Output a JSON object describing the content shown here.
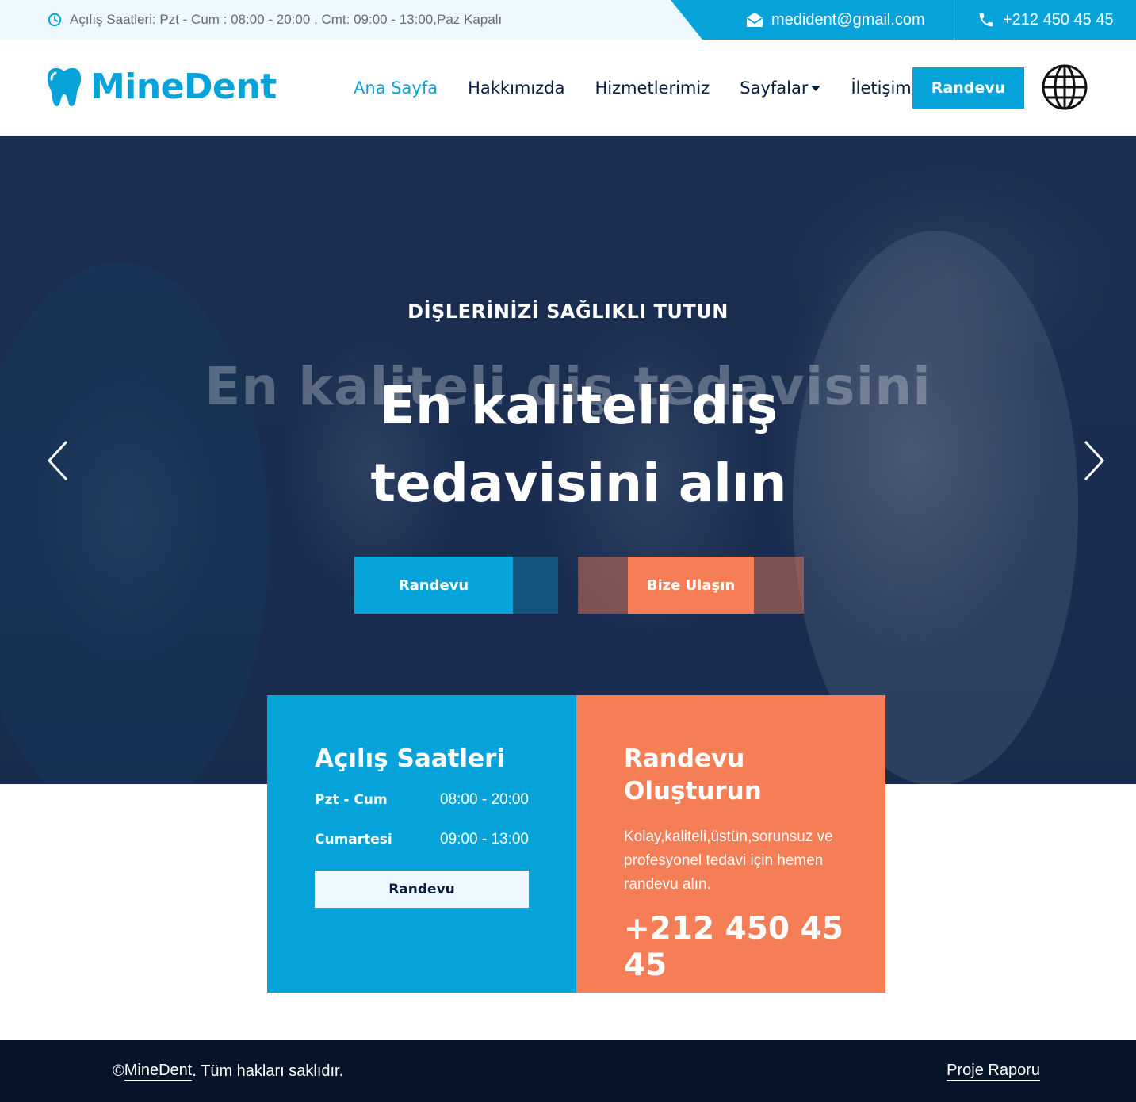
{
  "topbar": {
    "hours": "Açılış Saatleri: Pzt - Cum : 08:00 - 20:00 , Cmt: 09:00 - 13:00,Paz Kapalı",
    "email": "medident@gmail.com",
    "phone": "+212 450 45 45"
  },
  "brand": {
    "name": "MineDent"
  },
  "nav": {
    "items": [
      {
        "label": "Ana Sayfa",
        "active": true
      },
      {
        "label": "Hakkımızda"
      },
      {
        "label": "Hizmetlerimiz"
      },
      {
        "label": "Sayfalar",
        "dropdown": true
      },
      {
        "label": "İletişim"
      }
    ],
    "cta": "Randevu",
    "language_icon": "globe-icon"
  },
  "hero": {
    "kicker": "DİŞLERİNİZİ SAĞLIKLI TUTUN",
    "ghost_title": "En kaliteli diş tedavisini",
    "title": "En kaliteli diş tedavisini alın",
    "primary_button": "Randevu",
    "secondary_button": "Bize Ulaşın",
    "prev_icon": "chevron-left-icon",
    "next_icon": "chevron-right-icon"
  },
  "hours_card": {
    "title": "Açılış Saatleri",
    "rows": [
      {
        "day": "Pzt - Cum",
        "time": "08:00 - 20:00"
      },
      {
        "day": "Cumartesi",
        "time": "09:00 - 13:00"
      }
    ],
    "button": "Randevu"
  },
  "appointment_card": {
    "title": "Randevu Oluşturun",
    "description": "Kolay,kaliteli,üstün,sorunsuz ve profesyonel tedavi için hemen randevu alın.",
    "phone": "+212 450 45 45"
  },
  "footer": {
    "copyright_symbol": "©",
    "brand_link": "MineDent",
    "rights": ". Tüm hakları saklıdır.",
    "report_link": "Proje Raporu"
  },
  "colors": {
    "primary": "#06a3da",
    "secondary": "#f57e57",
    "dark": "#091e3e",
    "footer": "#061429",
    "light": "#eef9ff"
  }
}
